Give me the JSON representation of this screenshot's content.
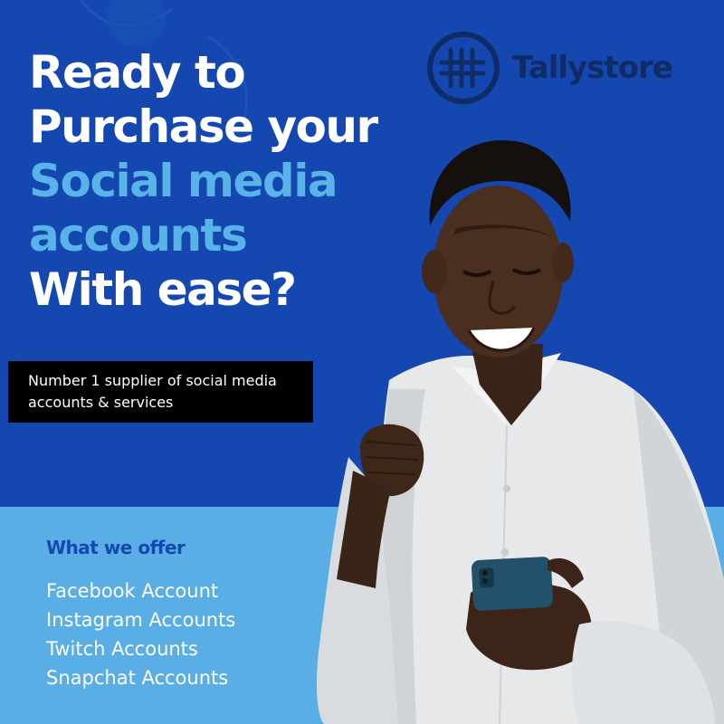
{
  "colors": {
    "background_top": "#1448b0",
    "background_bottom": "#5aaee6",
    "accent_text": "#5ab3e8",
    "logo_color": "#0f2c66"
  },
  "headline": {
    "line1": "Ready to",
    "line2": "Purchase your",
    "line3": "Social media",
    "line4": "accounts",
    "line5": "With ease?"
  },
  "logo": {
    "icon": "tally-marks-circle-icon",
    "text": "Tallystore"
  },
  "tagline": {
    "line1": "Number 1 supplier of social media",
    "line2": "accounts & services"
  },
  "offers": {
    "title": "What we offer",
    "items": [
      "Facebook Account",
      "Instagram Accounts",
      "Twitch Accounts",
      "Snapchat Accounts"
    ]
  }
}
